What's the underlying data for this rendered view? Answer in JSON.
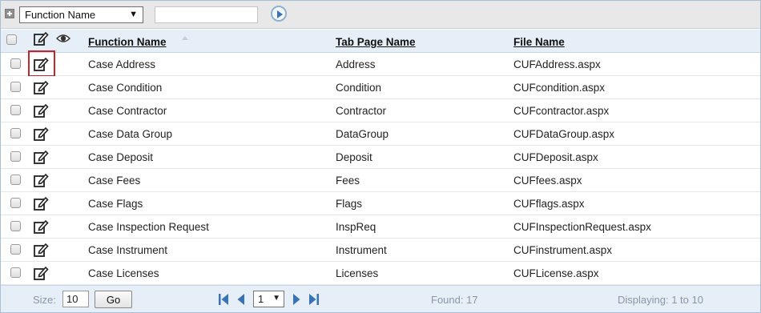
{
  "toolbar": {
    "filter_field": "Function Name",
    "filter_arrow": "▼",
    "search_value": ""
  },
  "columns": {
    "function_name": "Function Name",
    "tab_page_name": "Tab Page Name",
    "file_name": "File Name"
  },
  "rows": [
    {
      "function": "Case Address",
      "tab": "Address",
      "file": "CUFAddress.aspx",
      "selected": true
    },
    {
      "function": "Case Condition",
      "tab": "Condition",
      "file": "CUFcondition.aspx",
      "selected": false
    },
    {
      "function": "Case Contractor",
      "tab": "Contractor",
      "file": "CUFcontractor.aspx",
      "selected": false
    },
    {
      "function": "Case Data Group",
      "tab": "DataGroup",
      "file": "CUFDataGroup.aspx",
      "selected": false
    },
    {
      "function": "Case Deposit",
      "tab": "Deposit",
      "file": "CUFDeposit.aspx",
      "selected": false
    },
    {
      "function": "Case Fees",
      "tab": "Fees",
      "file": "CUFfees.aspx",
      "selected": false
    },
    {
      "function": "Case Flags",
      "tab": "Flags",
      "file": "CUFflags.aspx",
      "selected": false
    },
    {
      "function": "Case Inspection Request",
      "tab": "InspReq",
      "file": "CUFInspectionRequest.aspx",
      "selected": false
    },
    {
      "function": "Case Instrument",
      "tab": "Instrument",
      "file": "CUFinstrument.aspx",
      "selected": false
    },
    {
      "function": "Case Licenses",
      "tab": "Licenses",
      "file": "CUFLicense.aspx",
      "selected": false
    }
  ],
  "footer": {
    "size_label": "Size:",
    "size_value": "10",
    "go_label": "Go",
    "page_value": "1",
    "page_arrow": "▼",
    "found": "Found: 17",
    "displaying": "Displaying: 1 to 10"
  },
  "colors": {
    "accent": "#3a73b5",
    "selection_outline": "#c0282d",
    "header_bg": "#e6eef8"
  },
  "icons": [
    "plus-icon",
    "go-arrow-icon",
    "edit-icon",
    "eye-icon",
    "first-page-icon",
    "prev-page-icon",
    "next-page-icon",
    "last-page-icon"
  ]
}
